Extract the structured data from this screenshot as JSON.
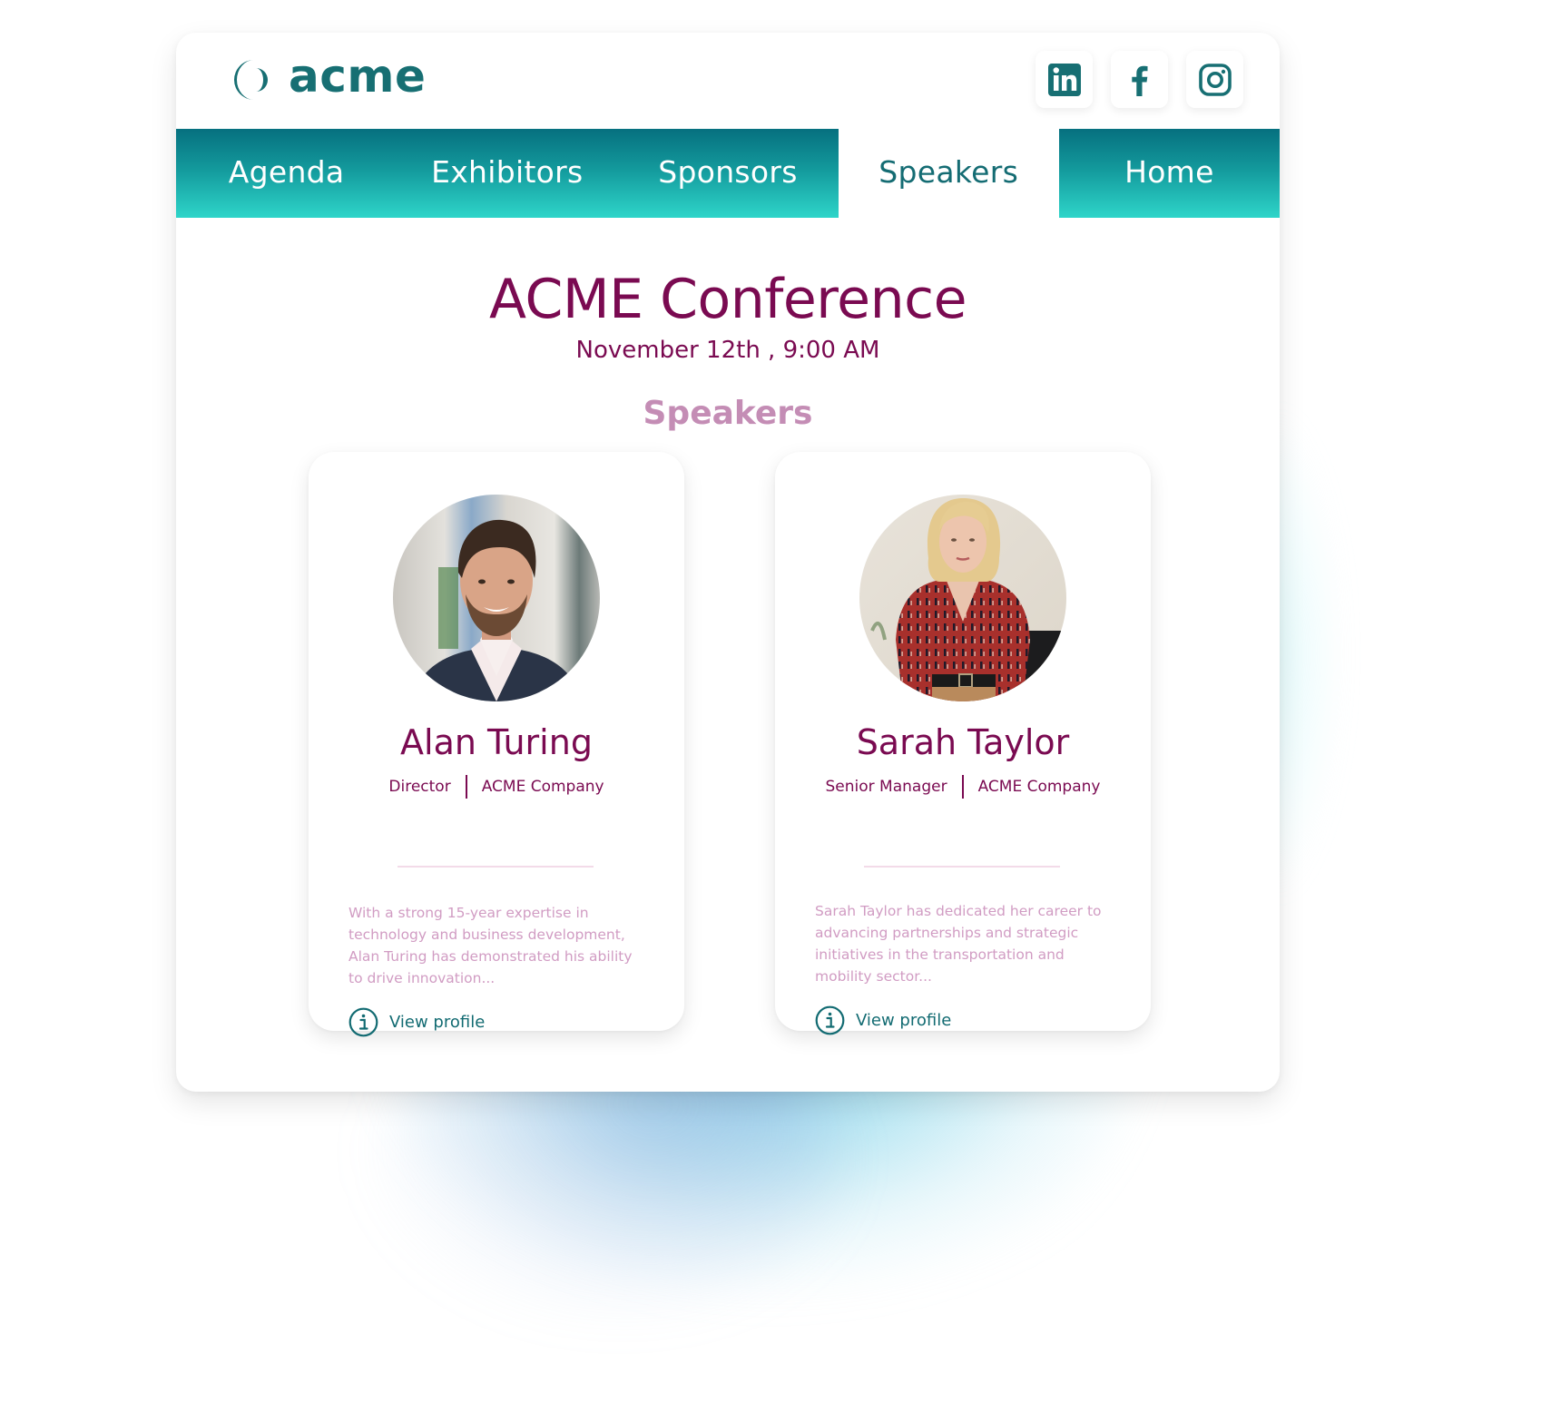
{
  "brand": {
    "name": "acme",
    "primary_color": "#176f73",
    "accent_color": "#7a0a51",
    "muted_accent": "#c48db5",
    "nav_gradient_top": "#06707f",
    "nav_gradient_bottom": "#2ed5c9"
  },
  "social": [
    {
      "name": "linkedin",
      "icon": "linkedin-icon"
    },
    {
      "name": "facebook",
      "icon": "facebook-icon"
    },
    {
      "name": "instagram",
      "icon": "instagram-icon"
    }
  ],
  "nav": {
    "tabs": [
      {
        "label": "Agenda",
        "active": false
      },
      {
        "label": "Exhibitors",
        "active": false
      },
      {
        "label": "Sponsors",
        "active": false
      },
      {
        "label": "Speakers",
        "active": true
      },
      {
        "label": "Home",
        "active": false
      }
    ]
  },
  "event": {
    "title": "ACME Conference",
    "datetime": "November 12th , 9:00 AM"
  },
  "section": {
    "title": "Speakers"
  },
  "speakers": [
    {
      "name": "Alan Turing",
      "role": "Director",
      "company": "ACME Company",
      "bio": "With a strong 15-year expertise in technology and business development, Alan Turing has demonstrated his ability to drive innovation...",
      "link_label": "View profile",
      "avatar": "man-portrait-photo"
    },
    {
      "name": "Sarah Taylor",
      "role": "Senior Manager",
      "company": "ACME Company",
      "bio": "Sarah Taylor has dedicated her career to advancing partnerships and strategic initiatives in the transportation and mobility sector...",
      "link_label": "View profile",
      "avatar": "woman-portrait-photo"
    }
  ]
}
